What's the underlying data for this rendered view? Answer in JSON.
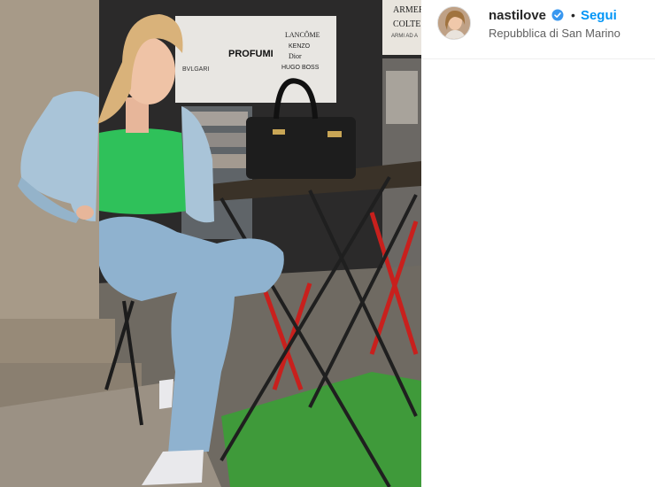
{
  "post": {
    "username": "nastilove",
    "verified": true,
    "separator": "•",
    "follow_label": "Segui",
    "location": "Repubblica di San Marino"
  },
  "storefront": {
    "sign_lines": [
      "BVLGARI",
      "PROFUMI",
      "LANCÔME",
      "KENZO",
      "Dior",
      "HUGO BOSS"
    ],
    "shop_sign": [
      "ARMER",
      "COLTE",
      "ARMI AD A"
    ]
  },
  "colors": {
    "follow_blue": "#0095f6",
    "verified_blue": "#3897f0",
    "top_green": "#2fc15a",
    "denim": "#8fb2cf",
    "grass": "#3f9a3a"
  },
  "icons": {
    "verified": "verified-badge-icon"
  }
}
